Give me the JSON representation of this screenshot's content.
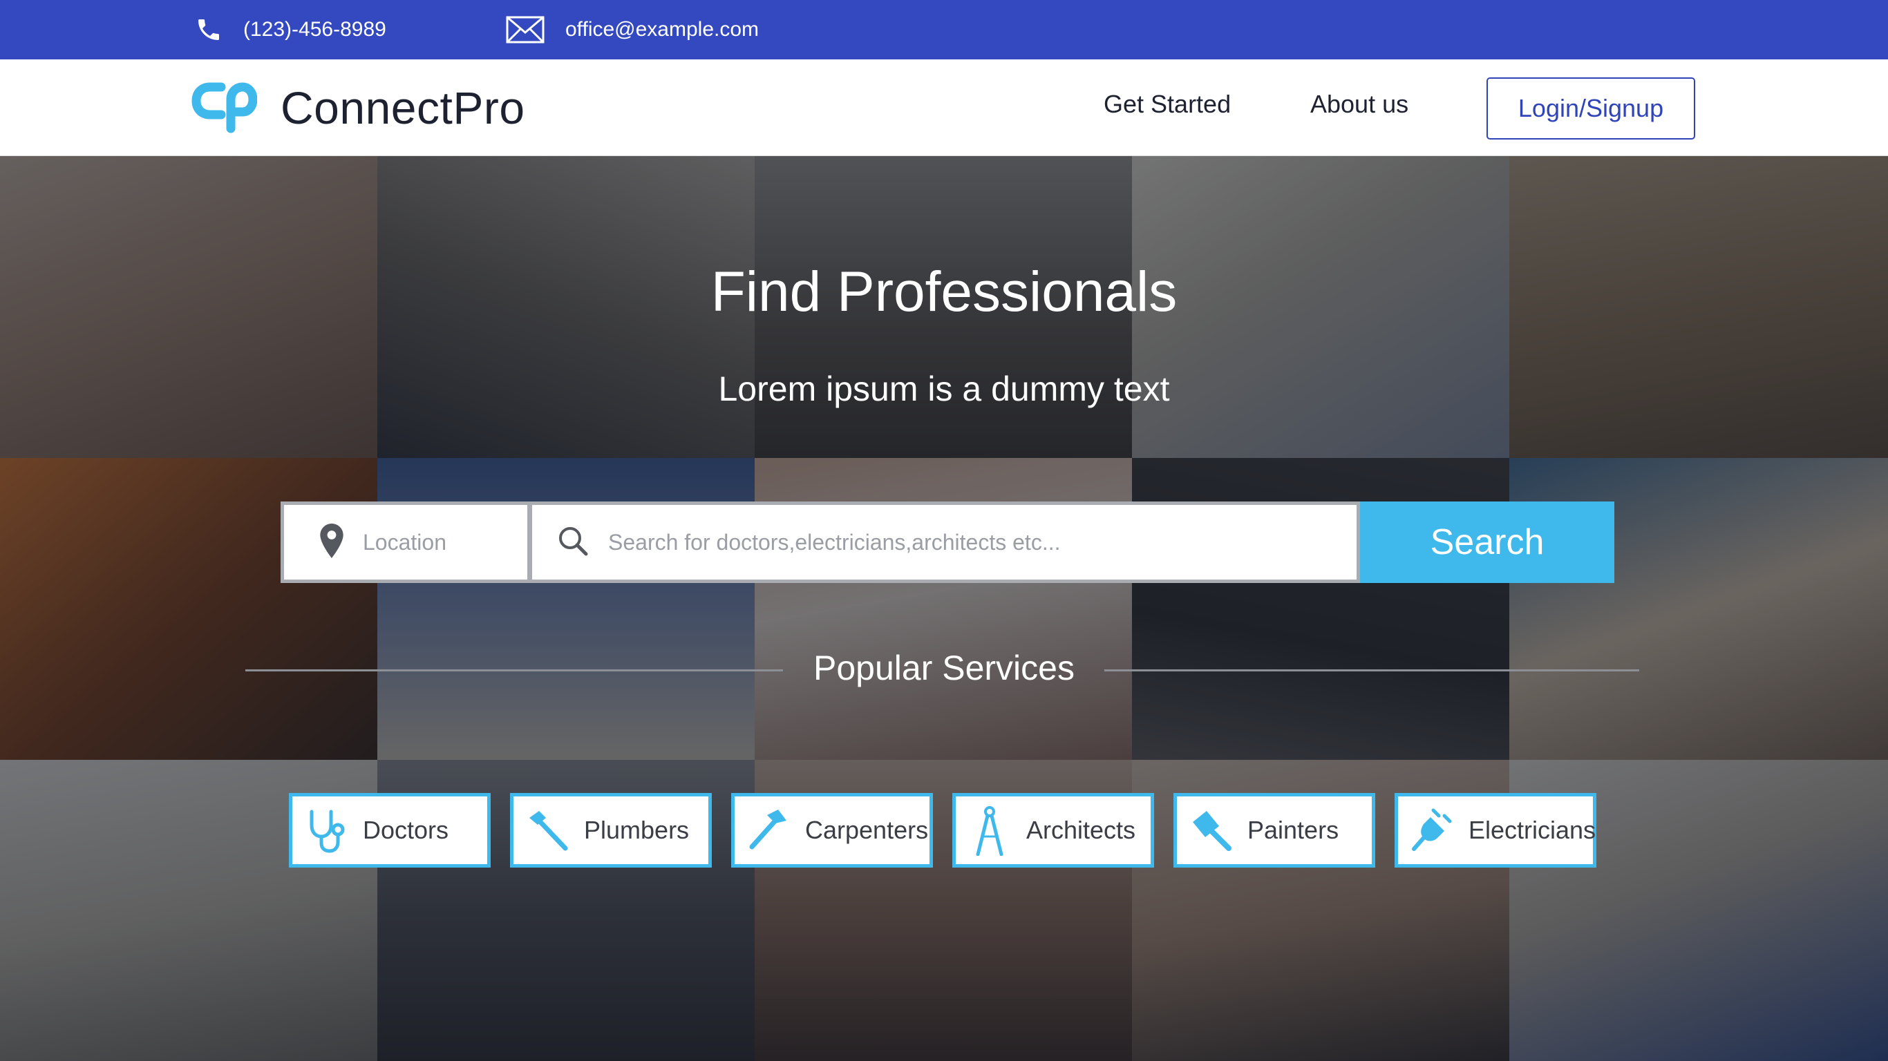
{
  "topbar": {
    "phone": "(123)-456-8989",
    "email": "office@example.com",
    "phone_icon": "phone-icon",
    "email_icon": "envelope-icon",
    "background": "#3449c0"
  },
  "navbar": {
    "brand_name": "ConnectPro",
    "logo_icon": "cp-logo-icon",
    "links": [
      "Get Started",
      "About us"
    ],
    "login_label": "Login/Signup",
    "accent": "#2f44b8"
  },
  "hero": {
    "title": "Find Professionals",
    "subtitle": "Lorem ipsum is a dummy text",
    "background_icon": "professionals-photo-collage"
  },
  "search": {
    "location_placeholder": "Location",
    "query_placeholder": "Search for doctors,electricians,architects etc...",
    "button_label": "Search",
    "location_icon": "map-pin-icon",
    "query_icon": "magnifier-icon",
    "button_color": "#3fb9ec"
  },
  "popular": {
    "title": "Popular Services",
    "services": [
      {
        "label": "Doctors",
        "icon": "stethoscope-icon"
      },
      {
        "label": "Plumbers",
        "icon": "hammer-icon"
      },
      {
        "label": "Carpenters",
        "icon": "hammer-icon"
      },
      {
        "label": "Architects",
        "icon": "compass-icon"
      },
      {
        "label": "Painters",
        "icon": "paint-roller-icon"
      },
      {
        "label": "Electricians",
        "icon": "plug-icon"
      }
    ],
    "accent": "#3fb9ec"
  }
}
